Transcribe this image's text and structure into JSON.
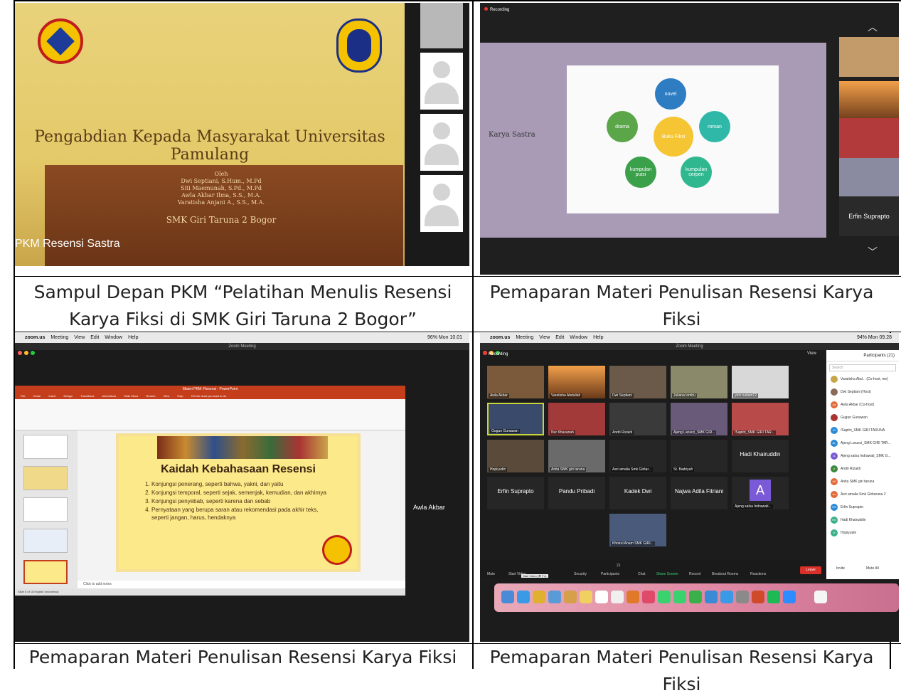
{
  "panels": {
    "p1": {
      "slide_title": "Pengabdian Kepada Masyarakat Universitas Pamulang",
      "authors_label": "Oleh",
      "authors": [
        "Dwi Septiani, S.Hum., M.Pd",
        "Siti Maemunah, S.Pd., M.Pd",
        "Awla Akbar Ilma, S.S., M.A.",
        "Varatisha Anjani A., S.S., M.A."
      ],
      "school": "SMK Giri Taruna 2 Bogor",
      "meeting_name": "PKM Resensi Sastra",
      "caption": "Sampul Depan PKM “Pelatihan Menulis Resensi Karya Fiksi di SMK Giri Taruna 2 Bogor”"
    },
    "p2": {
      "recording": "Recording",
      "slide_side_label": "Karya Sastra",
      "center": "Buku Fiksi",
      "nodes": [
        "novel",
        "roman",
        "kumpulan cerpen",
        "kumpulan puisi",
        "drama"
      ],
      "speaker": "Erfin Suprapto",
      "caption": "Pemaparan Materi Penulisan Resensi Karya Fiksi"
    },
    "p3": {
      "menu": [
        "zoom.us",
        "Meeting",
        "View",
        "Edit",
        "Window",
        "Help"
      ],
      "status_right": "96%  Mon 10.01",
      "window_title": "Zoom Meeting",
      "ppt_title": "Materi PKM- Resensi - PowerPoint",
      "ppt_tabs": [
        "File",
        "Home",
        "Insert",
        "Design",
        "Transitions",
        "Animations",
        "Slide Show",
        "Review",
        "View",
        "Help",
        "Tell me what you want to do"
      ],
      "heading": "Kaidah Kebahasaan Resensi",
      "items": [
        "Konjungsi penerang, seperti bahwa, yakni, dan yaitu",
        "Konjungsi temporal, seperti sejak, semenjak, kemudian, dan akhirnya",
        "Konjungsi penyebab, seperti karena dan sebab",
        "Pernyataan yang berupa saran atau rekomendasi pada akhir teks, seperti jangan, harus, hendaknya"
      ],
      "notes": "Click to add notes",
      "status": "Slide 8 of 18   English (Indonesia)",
      "speaker": "Awla Akbar",
      "caption": "Pemaparan Materi Penulisan Resensi Karya Fiksi"
    },
    "p4": {
      "menu": [
        "zoom.us",
        "Meeting",
        "View",
        "Edit",
        "Window",
        "Help"
      ],
      "status_right": "94%  Mon 09.28",
      "window_title": "Zoom Meeting",
      "recording": "Recording",
      "view_label": "View",
      "tiles": [
        "Awla Akbar",
        "Varatisha Abdullah",
        "Dwi Septiani",
        "Juliana lombu",
        "yosi rustam12",
        "Gugun Gunawan",
        "Nur Khasanah",
        "Andri Rizaldi",
        "Ajeng Larusci_SMK GIR...",
        "/Sapitri_SMK GIRI TAR...",
        "Hopiyudin",
        "Anita SMK giri taruna",
        "Asri amalia Smk Giritar...",
        "St. Badriyah",
        "Hadi Khairuddin",
        "Erfin Suprapto",
        "Pandu Pribadi",
        "Kadek Dwi",
        "Najwa Adila Fitriani",
        "Ajeng salsa Indrawati...",
        "Khoirul Anam SMK GIRI..."
      ],
      "avatar_letter": "A",
      "toolbar": [
        "Mute",
        "Start Video",
        "Security",
        "Participants",
        "Chat",
        "Share Screen",
        "Record",
        "Breakout Rooms",
        "Reactions"
      ],
      "participant_count": "21",
      "leave": "Leave",
      "tooltip": "Start Video (⌘⇧V)",
      "participants_title": "Participants (21)",
      "search": "Search",
      "participants": [
        {
          "name": "Varatisha Abd... (Co-host, me)",
          "initials": "",
          "color": "#c9a54a"
        },
        {
          "name": "Dwi Septiani (Host)",
          "initials": "",
          "color": "#8a6b5a"
        },
        {
          "name": "Awla Akbar (Co-host)",
          "initials": "AA",
          "color": "#e06a3b"
        },
        {
          "name": "Gugun Gunawan",
          "initials": "",
          "color": "#a33"
        },
        {
          "name": "/Sapitri_SMK GIRI TARUNA",
          "initials": "/G",
          "color": "#2b8ad6"
        },
        {
          "name": "Ajeng Larusci_SMK GIRI TAR...",
          "initials": "AL",
          "color": "#2b8ad6"
        },
        {
          "name": "Ajeng salsa Indrawati_SMK G...",
          "initials": "A",
          "color": "#7a5ad6"
        },
        {
          "name": "Andri Rizaldi",
          "initials": "A",
          "color": "#3b8a3b"
        },
        {
          "name": "Anita SMK giri taruna",
          "initials": "AS",
          "color": "#e06a3b"
        },
        {
          "name": "Asri amalia Smk Giritaruna 2",
          "initials": "As",
          "color": "#e06a3b"
        },
        {
          "name": "Erfin Suprapto",
          "initials": "ES",
          "color": "#2b8ad6"
        },
        {
          "name": "Hadi Khairuddin",
          "initials": "HK",
          "color": "#3bb08a"
        },
        {
          "name": "Hopiyudin",
          "initials": "H",
          "color": "#3bb08a"
        }
      ],
      "footer": [
        "Invite",
        "Mute All"
      ],
      "caption": "Pemaparan Materi Penulisan Resensi Karya Fiksi"
    }
  }
}
